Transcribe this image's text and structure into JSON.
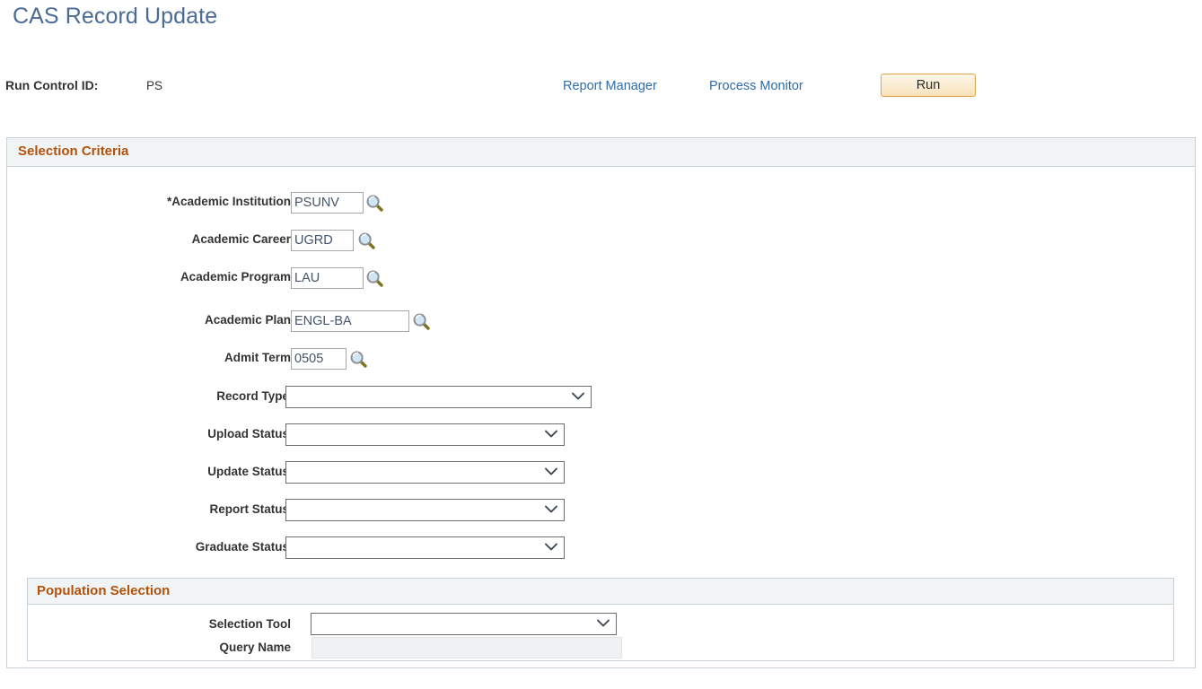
{
  "page": {
    "title": "CAS Record Update"
  },
  "run_control": {
    "label": "Run Control ID:",
    "value": "PS",
    "report_manager_link": "Report Manager",
    "process_monitor_link": "Process Monitor",
    "run_button": "Run"
  },
  "selection_criteria": {
    "title": "Selection Criteria",
    "fields": [
      {
        "label": "*Academic Institution",
        "value": "PSUNV",
        "type": "lookup"
      },
      {
        "label": "Academic Career",
        "value": "UGRD",
        "type": "lookup"
      },
      {
        "label": "Academic Program",
        "value": "LAU",
        "type": "lookup"
      },
      {
        "label": "Academic Plan",
        "value": "ENGL-BA",
        "type": "lookup"
      },
      {
        "label": "Admit Term",
        "value": "0505",
        "type": "lookup"
      },
      {
        "label": "Record Type",
        "value": "",
        "type": "dropdown"
      },
      {
        "label": "Upload Status",
        "value": "",
        "type": "dropdown"
      },
      {
        "label": "Update Status",
        "value": "",
        "type": "dropdown"
      },
      {
        "label": "Report Status",
        "value": "",
        "type": "dropdown"
      },
      {
        "label": "Graduate Status",
        "value": "",
        "type": "dropdown"
      }
    ]
  },
  "population_selection": {
    "title": "Population Selection",
    "selection_tool": {
      "label": "Selection Tool",
      "value": ""
    },
    "query_name": {
      "label": "Query Name",
      "value": ""
    }
  },
  "icons": {
    "lookup": "magnifying-glass-icon",
    "chevron": "chevron-down-icon"
  },
  "colors": {
    "title_blue": "#4a6b96",
    "link_blue": "#2f6ca8",
    "section_header_orange": "#b4510a",
    "panel_bg": "#f1f4f5",
    "panel_border": "#c9d2da",
    "run_button_border": "#e0a24a"
  }
}
